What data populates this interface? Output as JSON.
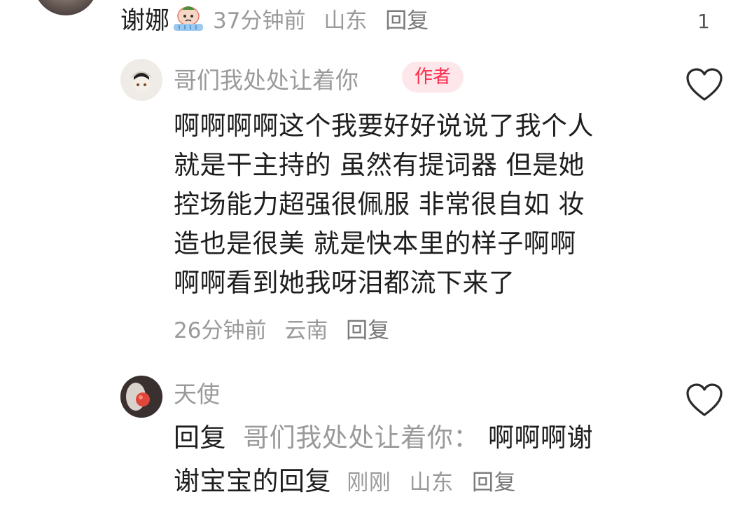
{
  "top_comment": {
    "username": "谢娜",
    "time": "37分钟前",
    "location": "山东",
    "reply_label": "回复",
    "like_count": "1",
    "emoji_icon": "crying-face-icon"
  },
  "reply1": {
    "username": "哥们我处处让着你",
    "author_badge": "作者",
    "lines": [
      "啊啊啊啊这个我要好好说说了我个人",
      "就是干主持的 虽然有提词器 但是她",
      "控场能力超强很佩服 非常很自如 妆",
      "造也是很美 就是快本里的样子啊啊",
      "啊啊看到她我呀泪都流下来了"
    ],
    "time": "26分钟前",
    "location": "云南",
    "reply_label": "回复"
  },
  "reply2": {
    "username": "天使",
    "reply_prefix": "回复",
    "reply_to": "哥们我处处让着你：",
    "line1_text": "啊啊啊谢",
    "line2_text": "谢宝宝的回复",
    "time": "刚刚",
    "location": "山东",
    "reply_label": "回复"
  },
  "colors": {
    "text": "#1e1e1e",
    "muted": "#9a9a9a",
    "badge_bg": "#fde7ea",
    "badge_text": "#ff2a4a"
  }
}
